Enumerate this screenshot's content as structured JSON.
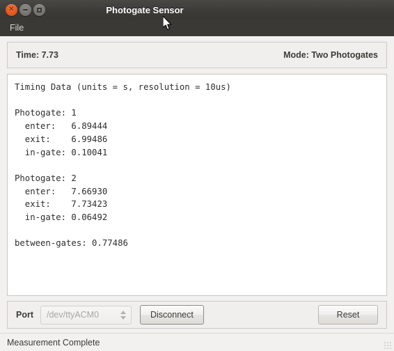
{
  "window": {
    "title": "Photogate Sensor",
    "controls": {
      "close_label": "×",
      "minimize_label": "–",
      "maximize_label": "□"
    }
  },
  "menubar": {
    "items": [
      {
        "label": "File"
      }
    ]
  },
  "info_panel": {
    "time_label": "Time: 7.73",
    "mode_label": "Mode: Two Photogates"
  },
  "timing_output": {
    "header": "Timing Data (units = s, resolution = 10us)",
    "lines": [
      "Timing Data (units = s, resolution = 10us)",
      "",
      "Photogate: 1",
      "  enter:   6.89444",
      "  exit:    6.99486",
      "  in-gate: 0.10041",
      "",
      "Photogate: 2",
      "  enter:   7.66930",
      "  exit:    7.73423",
      "  in-gate: 0.06492",
      "",
      "between-gates: 0.77486"
    ],
    "text": "Timing Data (units = s, resolution = 10us)\n\nPhotogate: 1\n  enter:   6.89444\n  exit:    6.99486\n  in-gate: 0.10041\n\nPhotogate: 2\n  enter:   7.66930\n  exit:    7.73423\n  in-gate: 0.06492\n\nbetween-gates: 0.77486",
    "measurements": {
      "units": "s",
      "resolution": "10us",
      "photogate_1": {
        "enter": "6.89444",
        "exit": "6.99486",
        "in_gate": "0.10041"
      },
      "photogate_2": {
        "enter": "7.66930",
        "exit": "7.73423",
        "in_gate": "0.06492"
      },
      "between_gates": "0.77486"
    }
  },
  "port_bar": {
    "label": "Port",
    "port_value": "/dev/ttyACM0",
    "disconnect_label": "Disconnect",
    "reset_label": "Reset"
  },
  "statusbar": {
    "message": "Measurement Complete"
  },
  "colors": {
    "titlebar": "#3c3b37",
    "window_bg": "#f2f1f0",
    "close_button": "#e2561e",
    "text_panel_bg": "#ffffff"
  }
}
